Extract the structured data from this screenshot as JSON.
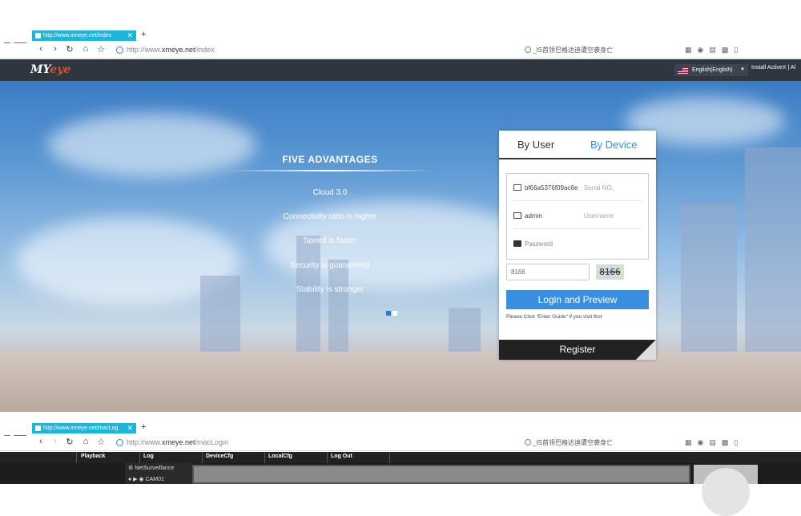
{
  "browser1": {
    "tab_title": "http://www.xmeye.net/index",
    "tab_close": "✕",
    "new_tab": "+",
    "url_prefix": "http://www.",
    "url_domain": "xmeye.net",
    "url_path": "/index",
    "search_text": "_IS首领巴格达迪遭空袭身亡"
  },
  "browser2": {
    "tab_title": "http://www.xmeye.net/macLog",
    "tab_close": "✕",
    "new_tab": "+",
    "url_prefix": "http://www.",
    "url_domain": "xmeye.net",
    "url_path": "/macLogin",
    "search_text": "_IS首领巴格达迪遭空袭身亡"
  },
  "site": {
    "logo_prefix": "MY",
    "logo_suffix": "eye",
    "language": "English(English)",
    "install": "Install ActiveX  |  Al"
  },
  "hero": {
    "title": "FIVE ADVANTAGES",
    "items": [
      "Cloud 3.0",
      "Connectivity ratio is higher",
      "Speed is faster",
      "Security is guaranteed",
      "Stability is stronger"
    ]
  },
  "login": {
    "tab_user": "By User",
    "tab_device": "By Device",
    "serial_value": "bf66a5376f09ac6e",
    "serial_placeholder": "Serial NO.",
    "username_value": "admin",
    "username_placeholder": "Username",
    "password_placeholder": "Password",
    "captcha_value": "8166",
    "captcha_image_text": "8166",
    "login_button": "Login and Preview",
    "hint": "Please Click \"Enter Guide\" if you visit first",
    "register": "Register"
  },
  "app": {
    "menu": [
      "Playback",
      "Log",
      "DeviceCfg",
      "LocalCfg",
      "Log Out"
    ],
    "tree_root": "NetSurveillance",
    "camera": "CAM01"
  },
  "colors": {
    "accent": "#3a8ee0",
    "tab": "#1fb4d9",
    "header": "#2e3640"
  }
}
